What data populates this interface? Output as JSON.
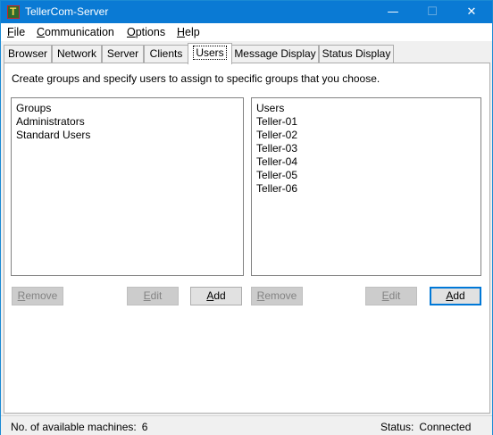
{
  "window": {
    "title": "TellerCom-Server",
    "controls": {
      "minimize": "—",
      "maximize": "☐",
      "close": "✕"
    }
  },
  "menu": {
    "file": {
      "mnemonic": "F",
      "rest": "ile"
    },
    "communication": {
      "mnemonic": "C",
      "rest": "ommunication"
    },
    "options": {
      "mnemonic": "O",
      "rest": "ptions"
    },
    "help": {
      "mnemonic": "H",
      "rest": "elp"
    }
  },
  "tabs": [
    "Browser",
    "Network",
    "Server",
    "Clients",
    "Users",
    "Message Display",
    "Status Display"
  ],
  "users_tab": {
    "description": "Create groups and specify users to assign to specific groups that you choose.",
    "groups": {
      "header": "Groups",
      "items": [
        "Administrators",
        "Standard Users"
      ],
      "remove": {
        "mnemonic": "R",
        "rest": "emove"
      },
      "edit": {
        "mnemonic": "E",
        "rest": "dit"
      },
      "add": {
        "mnemonic": "A",
        "rest": "dd"
      }
    },
    "users": {
      "header": "Users",
      "items": [
        "Teller-01",
        "Teller-02",
        "Teller-03",
        "Teller-04",
        "Teller-05",
        "Teller-06"
      ],
      "remove": {
        "mnemonic": "R",
        "rest": "emove"
      },
      "edit": {
        "mnemonic": "E",
        "rest": "dit"
      },
      "add": {
        "mnemonic": "A",
        "rest": "dd"
      }
    }
  },
  "status": {
    "machines_label": "No. of available machines:",
    "machines_value": "6",
    "status_label": "Status:",
    "status_value": "Connected"
  },
  "colors": {
    "titlebar": "#0a7ad4",
    "default_button_border": "#0078d7"
  }
}
